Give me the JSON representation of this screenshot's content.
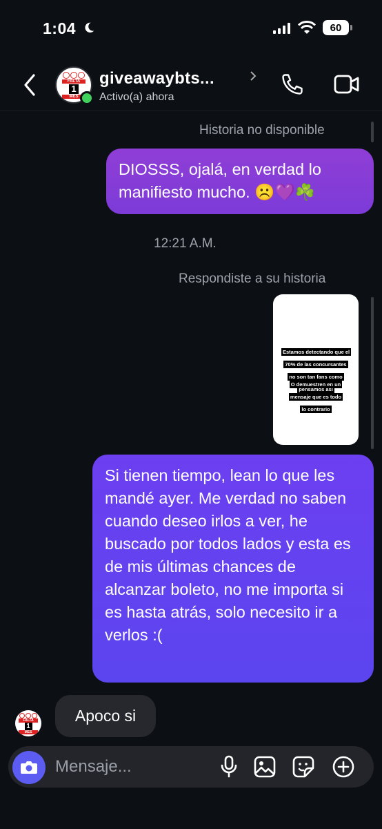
{
  "status_bar": {
    "time": "1:04",
    "battery": "60"
  },
  "header": {
    "contact_name": "giveawaybts...",
    "activity": "Activo(a) ahora",
    "avatar_logo": {
      "top_text": "FALTA",
      "number": "1",
      "bottom_text": "MES"
    }
  },
  "messages": {
    "story_unavailable": "Historia no disponible",
    "sent_1": "DIOSSS, ojalá, en verdad lo manifiesto mucho. ☹️💜☘️",
    "timestamp": "12:21 A.M.",
    "replied_label": "Respondiste a su historia",
    "story_preview": {
      "line_1": "Estamos detectando que el 70% de las concursantes no son tan fans como pensamos así",
      "line_2": "O demuestren en un mensaje que es todo lo contrario"
    },
    "sent_2": "Si tienen tiempo, lean lo que les mandé ayer. Me verdad no saben cuando deseo irlos a ver, he buscado por todos lados y esta es de mis últimas chances de alcanzar boleto, no me importa si es hasta atrás, solo necesito ir a verlos :(",
    "received_1": "Apoco si"
  },
  "composer": {
    "placeholder": "Mensaje..."
  },
  "colors": {
    "sent_top": "#8f3ed6",
    "sent_bottom": "#5b45ef",
    "received": "#26282d",
    "online": "#3ed15c",
    "camera": "#5c5cf2"
  },
  "icons": [
    "moon-icon",
    "signal-icon",
    "wifi-icon",
    "back-icon",
    "chevron-right-icon",
    "phone-icon",
    "video-icon",
    "camera-icon",
    "microphone-icon",
    "gallery-icon",
    "sticker-icon",
    "plus-icon"
  ]
}
